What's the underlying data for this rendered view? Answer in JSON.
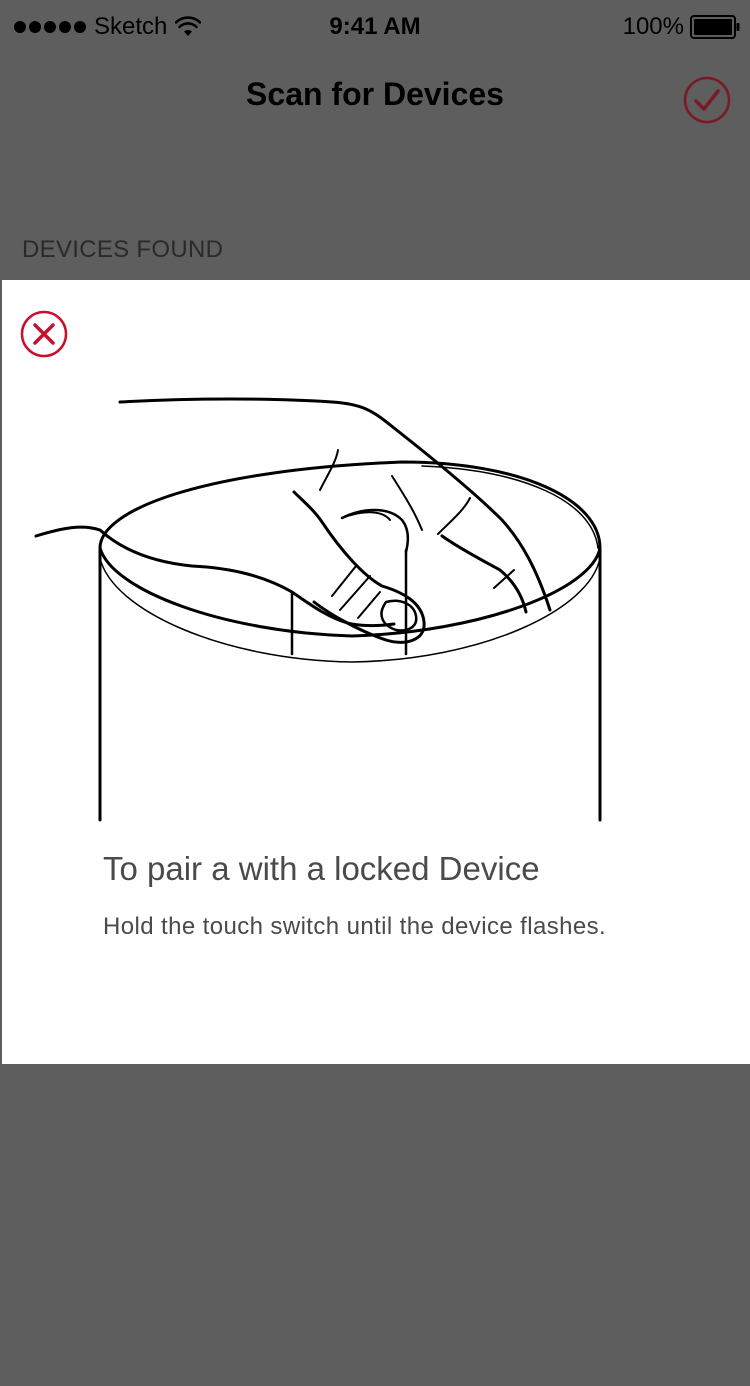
{
  "status_bar": {
    "carrier": "Sketch",
    "time": "9:41 AM",
    "battery": "100%"
  },
  "nav": {
    "title": "Scan for Devices",
    "done_icon": "checkmark-circle-icon"
  },
  "devices": {
    "section_header": "DEVICES FOUND"
  },
  "modal": {
    "close_icon": "close-circle-icon",
    "title": "To pair a with a locked Device",
    "description": "Hold the touch switch until the device flashes."
  },
  "colors": {
    "accent": "#c8102e",
    "overlay": "#5e5e5e"
  }
}
